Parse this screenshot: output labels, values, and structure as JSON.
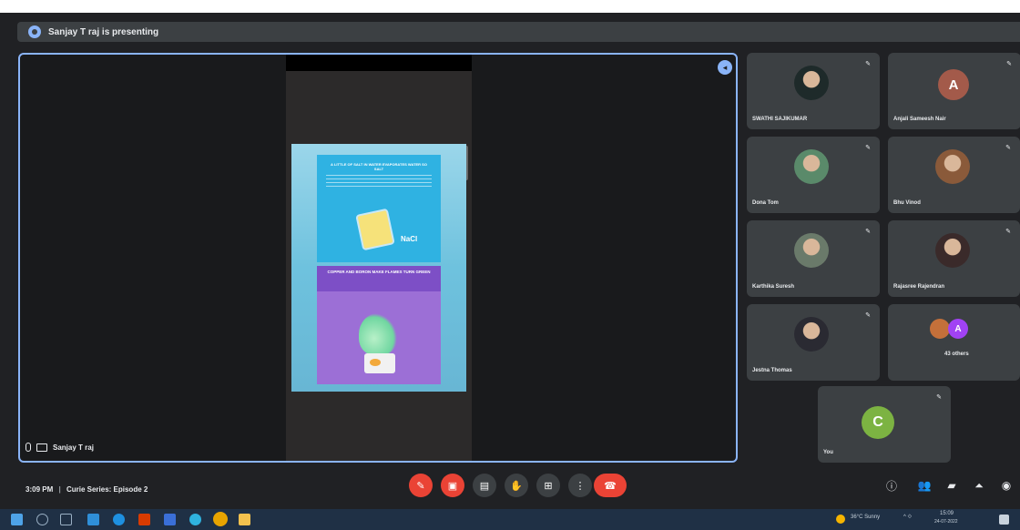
{
  "presenting": {
    "text": "Sanjay T raj is presenting"
  },
  "main_tile": {
    "presenter_name": "Sanjay T raj",
    "poster": {
      "panel1_title": "A LITTLE OF SALT IN WATER EVAPORATES WATER SO SALT",
      "panel1_label": "NaCl",
      "panel2_title": "COPPER AND BORON MAKE FLAMES TURN GREEN"
    }
  },
  "participants": [
    {
      "name": "SWATHI SAJIKUMAR",
      "kind": "photo",
      "color": "#1e2a2a"
    },
    {
      "name": "Anjali Sameesh Nair",
      "kind": "letter",
      "letter": "A",
      "color": "#a35a4a"
    },
    {
      "name": "Dona Tom",
      "kind": "photo",
      "color": "#5a8a6a"
    },
    {
      "name": "Bhu Vinod",
      "kind": "photo",
      "color": "#8a5a3a"
    },
    {
      "name": "Karthika Suresh",
      "kind": "photo",
      "color": "#6a7a6a"
    },
    {
      "name": "Rajasree Rajendran",
      "kind": "photo",
      "color": "#3a2a2a"
    },
    {
      "name": "Jestna Thomas",
      "kind": "photo",
      "color": "#2a2a32"
    },
    {
      "name": "43 others",
      "kind": "group",
      "letter": "A",
      "color": "#a142f4"
    }
  ],
  "self_tile": {
    "name": "You",
    "letter": "C",
    "color": "#7cb342"
  },
  "meeting": {
    "time": "3:09 PM",
    "separator": "|",
    "title": "Curie Series: Episode 2"
  },
  "controls": [
    {
      "name": "mic-off-button",
      "icon": "mic-off-icon",
      "glyph": "✎",
      "style": "red"
    },
    {
      "name": "camera-off-button",
      "icon": "camera-off-icon",
      "glyph": "▣",
      "style": "red"
    },
    {
      "name": "captions-button",
      "icon": "captions-icon",
      "glyph": "▤",
      "style": "gray"
    },
    {
      "name": "raise-hand-button",
      "icon": "hand-icon",
      "glyph": "✋",
      "style": "gray"
    },
    {
      "name": "present-button",
      "icon": "present-icon",
      "glyph": "⊞",
      "style": "gray"
    },
    {
      "name": "more-options-button",
      "icon": "more-vert-icon",
      "glyph": "⋮",
      "style": "gray"
    }
  ],
  "side_controls": [
    {
      "name": "info-button",
      "icon": "info-icon",
      "glyph": "ⓘ"
    },
    {
      "name": "people-button",
      "icon": "people-icon",
      "glyph": "👥"
    },
    {
      "name": "chat-button",
      "icon": "chat-icon",
      "glyph": "▰"
    },
    {
      "name": "activities-button",
      "icon": "activities-icon",
      "glyph": "⏶"
    },
    {
      "name": "host-controls-button",
      "icon": "shield-icon",
      "glyph": "◉"
    }
  ],
  "taskbar": {
    "weather": "36°C Sunny",
    "tray_icons": "^ ⟐",
    "time": "15:09",
    "date": "24-07-2022"
  },
  "colors": {
    "accent": "#8ab4f8",
    "danger": "#ea4335",
    "surface": "#3c4043",
    "background": "#202124"
  }
}
